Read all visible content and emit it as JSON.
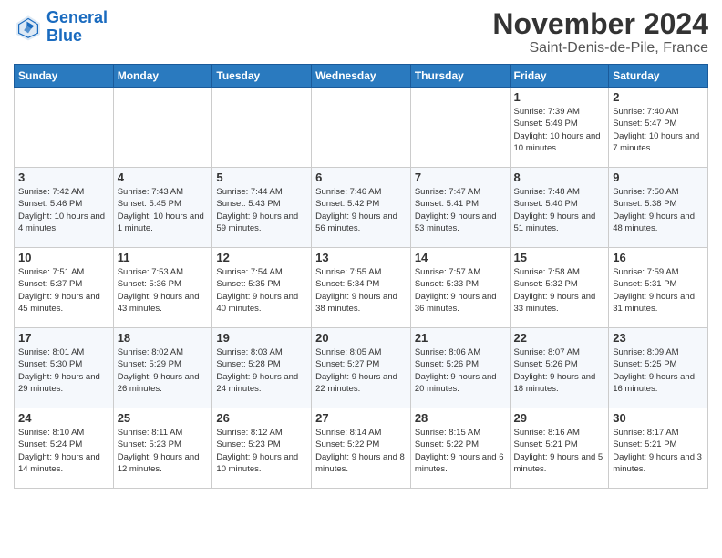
{
  "logo": {
    "text_general": "General",
    "text_blue": "Blue"
  },
  "header": {
    "month": "November 2024",
    "location": "Saint-Denis-de-Pile, France"
  },
  "weekdays": [
    "Sunday",
    "Monday",
    "Tuesday",
    "Wednesday",
    "Thursday",
    "Friday",
    "Saturday"
  ],
  "weeks": [
    [
      {
        "day": "",
        "info": ""
      },
      {
        "day": "",
        "info": ""
      },
      {
        "day": "",
        "info": ""
      },
      {
        "day": "",
        "info": ""
      },
      {
        "day": "",
        "info": ""
      },
      {
        "day": "1",
        "info": "Sunrise: 7:39 AM\nSunset: 5:49 PM\nDaylight: 10 hours and 10 minutes."
      },
      {
        "day": "2",
        "info": "Sunrise: 7:40 AM\nSunset: 5:47 PM\nDaylight: 10 hours and 7 minutes."
      }
    ],
    [
      {
        "day": "3",
        "info": "Sunrise: 7:42 AM\nSunset: 5:46 PM\nDaylight: 10 hours and 4 minutes."
      },
      {
        "day": "4",
        "info": "Sunrise: 7:43 AM\nSunset: 5:45 PM\nDaylight: 10 hours and 1 minute."
      },
      {
        "day": "5",
        "info": "Sunrise: 7:44 AM\nSunset: 5:43 PM\nDaylight: 9 hours and 59 minutes."
      },
      {
        "day": "6",
        "info": "Sunrise: 7:46 AM\nSunset: 5:42 PM\nDaylight: 9 hours and 56 minutes."
      },
      {
        "day": "7",
        "info": "Sunrise: 7:47 AM\nSunset: 5:41 PM\nDaylight: 9 hours and 53 minutes."
      },
      {
        "day": "8",
        "info": "Sunrise: 7:48 AM\nSunset: 5:40 PM\nDaylight: 9 hours and 51 minutes."
      },
      {
        "day": "9",
        "info": "Sunrise: 7:50 AM\nSunset: 5:38 PM\nDaylight: 9 hours and 48 minutes."
      }
    ],
    [
      {
        "day": "10",
        "info": "Sunrise: 7:51 AM\nSunset: 5:37 PM\nDaylight: 9 hours and 45 minutes."
      },
      {
        "day": "11",
        "info": "Sunrise: 7:53 AM\nSunset: 5:36 PM\nDaylight: 9 hours and 43 minutes."
      },
      {
        "day": "12",
        "info": "Sunrise: 7:54 AM\nSunset: 5:35 PM\nDaylight: 9 hours and 40 minutes."
      },
      {
        "day": "13",
        "info": "Sunrise: 7:55 AM\nSunset: 5:34 PM\nDaylight: 9 hours and 38 minutes."
      },
      {
        "day": "14",
        "info": "Sunrise: 7:57 AM\nSunset: 5:33 PM\nDaylight: 9 hours and 36 minutes."
      },
      {
        "day": "15",
        "info": "Sunrise: 7:58 AM\nSunset: 5:32 PM\nDaylight: 9 hours and 33 minutes."
      },
      {
        "day": "16",
        "info": "Sunrise: 7:59 AM\nSunset: 5:31 PM\nDaylight: 9 hours and 31 minutes."
      }
    ],
    [
      {
        "day": "17",
        "info": "Sunrise: 8:01 AM\nSunset: 5:30 PM\nDaylight: 9 hours and 29 minutes."
      },
      {
        "day": "18",
        "info": "Sunrise: 8:02 AM\nSunset: 5:29 PM\nDaylight: 9 hours and 26 minutes."
      },
      {
        "day": "19",
        "info": "Sunrise: 8:03 AM\nSunset: 5:28 PM\nDaylight: 9 hours and 24 minutes."
      },
      {
        "day": "20",
        "info": "Sunrise: 8:05 AM\nSunset: 5:27 PM\nDaylight: 9 hours and 22 minutes."
      },
      {
        "day": "21",
        "info": "Sunrise: 8:06 AM\nSunset: 5:26 PM\nDaylight: 9 hours and 20 minutes."
      },
      {
        "day": "22",
        "info": "Sunrise: 8:07 AM\nSunset: 5:26 PM\nDaylight: 9 hours and 18 minutes."
      },
      {
        "day": "23",
        "info": "Sunrise: 8:09 AM\nSunset: 5:25 PM\nDaylight: 9 hours and 16 minutes."
      }
    ],
    [
      {
        "day": "24",
        "info": "Sunrise: 8:10 AM\nSunset: 5:24 PM\nDaylight: 9 hours and 14 minutes."
      },
      {
        "day": "25",
        "info": "Sunrise: 8:11 AM\nSunset: 5:23 PM\nDaylight: 9 hours and 12 minutes."
      },
      {
        "day": "26",
        "info": "Sunrise: 8:12 AM\nSunset: 5:23 PM\nDaylight: 9 hours and 10 minutes."
      },
      {
        "day": "27",
        "info": "Sunrise: 8:14 AM\nSunset: 5:22 PM\nDaylight: 9 hours and 8 minutes."
      },
      {
        "day": "28",
        "info": "Sunrise: 8:15 AM\nSunset: 5:22 PM\nDaylight: 9 hours and 6 minutes."
      },
      {
        "day": "29",
        "info": "Sunrise: 8:16 AM\nSunset: 5:21 PM\nDaylight: 9 hours and 5 minutes."
      },
      {
        "day": "30",
        "info": "Sunrise: 8:17 AM\nSunset: 5:21 PM\nDaylight: 9 hours and 3 minutes."
      }
    ]
  ]
}
